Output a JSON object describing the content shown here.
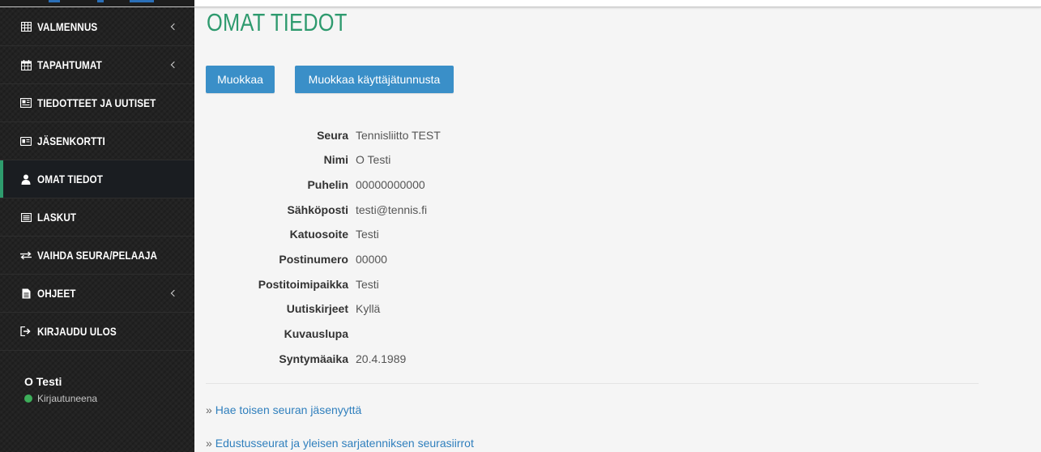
{
  "nav": [
    {
      "label": "VALMENNUS",
      "icon": "table-icon",
      "expandable": true
    },
    {
      "label": "TAPAHTUMAT",
      "icon": "calendar-icon",
      "expandable": true
    },
    {
      "label": "TIEDOTTEET JA UUTISET",
      "icon": "newspaper-icon",
      "expandable": false
    },
    {
      "label": "JÄSENKORTTI",
      "icon": "id-card-icon",
      "expandable": false
    },
    {
      "label": "OMAT TIEDOT",
      "icon": "user-icon",
      "expandable": false,
      "active": true
    },
    {
      "label": "LASKUT",
      "icon": "list-icon",
      "expandable": false
    },
    {
      "label": "VAIHDA SEURA/PELAAJA",
      "icon": "swap-icon",
      "expandable": false
    },
    {
      "label": "OHJEET",
      "icon": "document-icon",
      "expandable": true
    },
    {
      "label": "KIRJAUDU ULOS",
      "icon": "logout-icon",
      "expandable": false
    }
  ],
  "user": {
    "name": "O Testi",
    "status": "Kirjautuneena"
  },
  "page": {
    "title": "OMAT TIEDOT"
  },
  "actions": {
    "edit_label": "Muokkaa",
    "edit_user_label": "Muokkaa käyttäjätunnusta"
  },
  "info": [
    {
      "label": "Seura",
      "value": "Tennisliitto TEST"
    },
    {
      "label": "Nimi",
      "value": "O Testi"
    },
    {
      "label": "Puhelin",
      "value": "00000000000"
    },
    {
      "label": "Sähköposti",
      "value": "testi@tennis.fi"
    },
    {
      "label": "Katuosoite",
      "value": "Testi"
    },
    {
      "label": "Postinumero",
      "value": "00000"
    },
    {
      "label": "Postitoimipaikka",
      "value": "Testi"
    },
    {
      "label": "Uutiskirjeet",
      "value": "Kyllä"
    },
    {
      "label": "Kuvauslupa",
      "value": ""
    },
    {
      "label": "Syntymäaika",
      "value": "20.4.1989"
    }
  ],
  "links": {
    "prefix": "»",
    "items": [
      {
        "label": "Hae toisen seuran jäsenyyttä"
      },
      {
        "label": "Edustusseurat ja yleisen sarjatenniksen seurasiirrot"
      }
    ]
  },
  "colors": {
    "accent": "#2e9a6e",
    "button": "#3a8fc8",
    "link": "#2f7fbd",
    "status_online": "#3dae5a"
  }
}
